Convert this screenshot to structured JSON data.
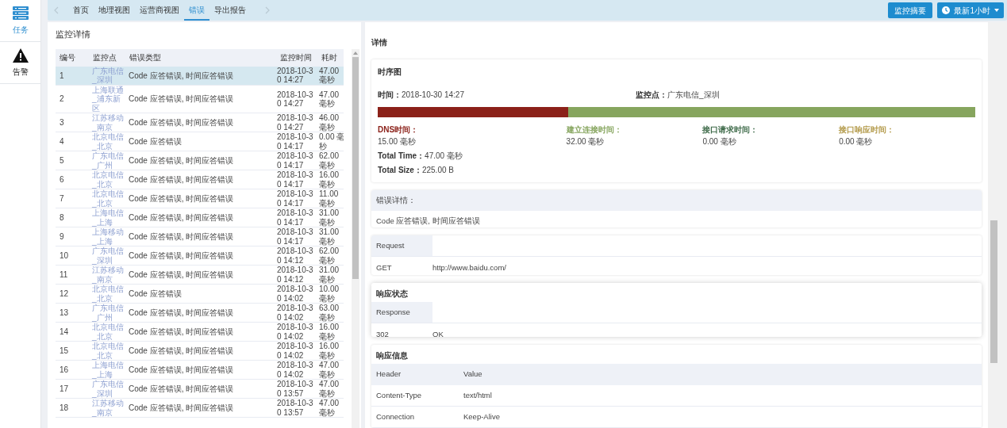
{
  "sidebar": {
    "items": [
      {
        "kind": "tasks",
        "label": "任务",
        "selected": true
      },
      {
        "kind": "alert",
        "label": "告警",
        "selected": false
      }
    ]
  },
  "tabs": [
    {
      "label": "首页",
      "selected": false
    },
    {
      "label": "地理视图",
      "selected": false
    },
    {
      "label": "运营商视图",
      "selected": false
    },
    {
      "label": "错误",
      "selected": true
    },
    {
      "label": "导出报告",
      "selected": false
    }
  ],
  "toolbar": {
    "summary_button": "监控摘要",
    "range_button": "最新1小时"
  },
  "monitor_panel": {
    "title": "监控详情",
    "columns": [
      "编号",
      "监控点",
      "错误类型",
      "监控时间",
      "耗时"
    ],
    "rows": [
      {
        "id": "1",
        "site": "广东电信_深圳",
        "error": "Code 应答错误, 时间应答错误",
        "time": "2018-10-30 14:27",
        "duration": "47.00 毫秒",
        "selected": true
      },
      {
        "id": "2",
        "site": "上海联通_浦东新区",
        "error": "Code 应答错误, 时间应答错误",
        "time": "2018-10-30 14:27",
        "duration": "47.00 毫秒",
        "selected": false
      },
      {
        "id": "3",
        "site": "江苏移动_南京",
        "error": "Code 应答错误, 时间应答错误",
        "time": "2018-10-30 14:27",
        "duration": "46.00 毫秒",
        "selected": false
      },
      {
        "id": "4",
        "site": "北京电信_北京",
        "error": "Code 应答错误",
        "time": "2018-10-30 14:17",
        "duration": "0.00 毫秒",
        "selected": false
      },
      {
        "id": "5",
        "site": "广东电信_广州",
        "error": "Code 应答错误, 时间应答错误",
        "time": "2018-10-30 14:17",
        "duration": "62.00 毫秒",
        "selected": false
      },
      {
        "id": "6",
        "site": "北京电信_北京",
        "error": "Code 应答错误, 时间应答错误",
        "time": "2018-10-30 14:17",
        "duration": "16.00 毫秒",
        "selected": false
      },
      {
        "id": "7",
        "site": "北京电信_北京",
        "error": "Code 应答错误, 时间应答错误",
        "time": "2018-10-30 14:17",
        "duration": "11.00 毫秒",
        "selected": false
      },
      {
        "id": "8",
        "site": "上海电信_上海",
        "error": "Code 应答错误, 时间应答错误",
        "time": "2018-10-30 14:17",
        "duration": "31.00 毫秒",
        "selected": false
      },
      {
        "id": "9",
        "site": "上海移动_上海",
        "error": "Code 应答错误, 时间应答错误",
        "time": "2018-10-30 14:17",
        "duration": "31.00 毫秒",
        "selected": false
      },
      {
        "id": "10",
        "site": "广东电信_深圳",
        "error": "Code 应答错误, 时间应答错误",
        "time": "2018-10-30 14:12",
        "duration": "62.00 毫秒",
        "selected": false
      },
      {
        "id": "11",
        "site": "江苏移动_南京",
        "error": "Code 应答错误, 时间应答错误",
        "time": "2018-10-30 14:12",
        "duration": "31.00 毫秒",
        "selected": false
      },
      {
        "id": "12",
        "site": "北京电信_北京",
        "error": "Code 应答错误",
        "time": "2018-10-30 14:02",
        "duration": "10.00 毫秒",
        "selected": false
      },
      {
        "id": "13",
        "site": "广东电信_广州",
        "error": "Code 应答错误, 时间应答错误",
        "time": "2018-10-30 14:02",
        "duration": "63.00 毫秒",
        "selected": false
      },
      {
        "id": "14",
        "site": "北京电信_北京",
        "error": "Code 应答错误, 时间应答错误",
        "time": "2018-10-30 14:02",
        "duration": "16.00 毫秒",
        "selected": false
      },
      {
        "id": "15",
        "site": "北京电信_北京",
        "error": "Code 应答错误, 时间应答错误",
        "time": "2018-10-30 14:02",
        "duration": "16.00 毫秒",
        "selected": false
      },
      {
        "id": "16",
        "site": "上海电信_上海",
        "error": "Code 应答错误, 时间应答错误",
        "time": "2018-10-30 14:02",
        "duration": "47.00 毫秒",
        "selected": false
      },
      {
        "id": "17",
        "site": "广东电信_深圳",
        "error": "Code 应答错误, 时间应答错误",
        "time": "2018-10-30 13:57",
        "duration": "47.00 毫秒",
        "selected": false
      },
      {
        "id": "18",
        "site": "江苏移动_南京",
        "error": "Code 应答错误, 时间应答错误",
        "time": "2018-10-30 13:57",
        "duration": "47.00 毫秒",
        "selected": false
      }
    ]
  },
  "detail": {
    "title": "详情",
    "timing": {
      "title": "时序图",
      "time_label": "时间：",
      "time_value": "2018-10-30 14:27",
      "site_label": "监控点：",
      "site_value": "广东电信_深圳",
      "segments": [
        {
          "label": "DNS时间：",
          "value": "15.00 毫秒",
          "color": "#8b2119"
        },
        {
          "label": "建立连接时间：",
          "value": "32.00 毫秒",
          "color": "#86a55e"
        },
        {
          "label": "接口请求时间：",
          "value": "0.00 毫秒",
          "color": "#3f6b4a"
        },
        {
          "label": "接口响应时间：",
          "value": "0.00 毫秒",
          "color": "#b39a4a"
        }
      ],
      "totals": [
        {
          "label": "Total Time：",
          "value": "47.00 毫秒"
        },
        {
          "label": "Total Size：",
          "value": "225.00 B"
        }
      ]
    },
    "error_detail": {
      "title": "错误详情：",
      "text": "Code 应答错误, 时间应答错误"
    },
    "request": {
      "header": "Request",
      "method": "GET",
      "url": "http://www.baidu.com/"
    },
    "response_status": {
      "title": "响应状态",
      "header": "Response",
      "code": "302",
      "text": "OK"
    },
    "response_info": {
      "title": "响应信息",
      "columns": [
        "Header",
        "Value"
      ],
      "rows": [
        [
          "Content-Type",
          "text/html"
        ],
        [
          "Connection",
          "Keep-Alive"
        ]
      ]
    }
  }
}
